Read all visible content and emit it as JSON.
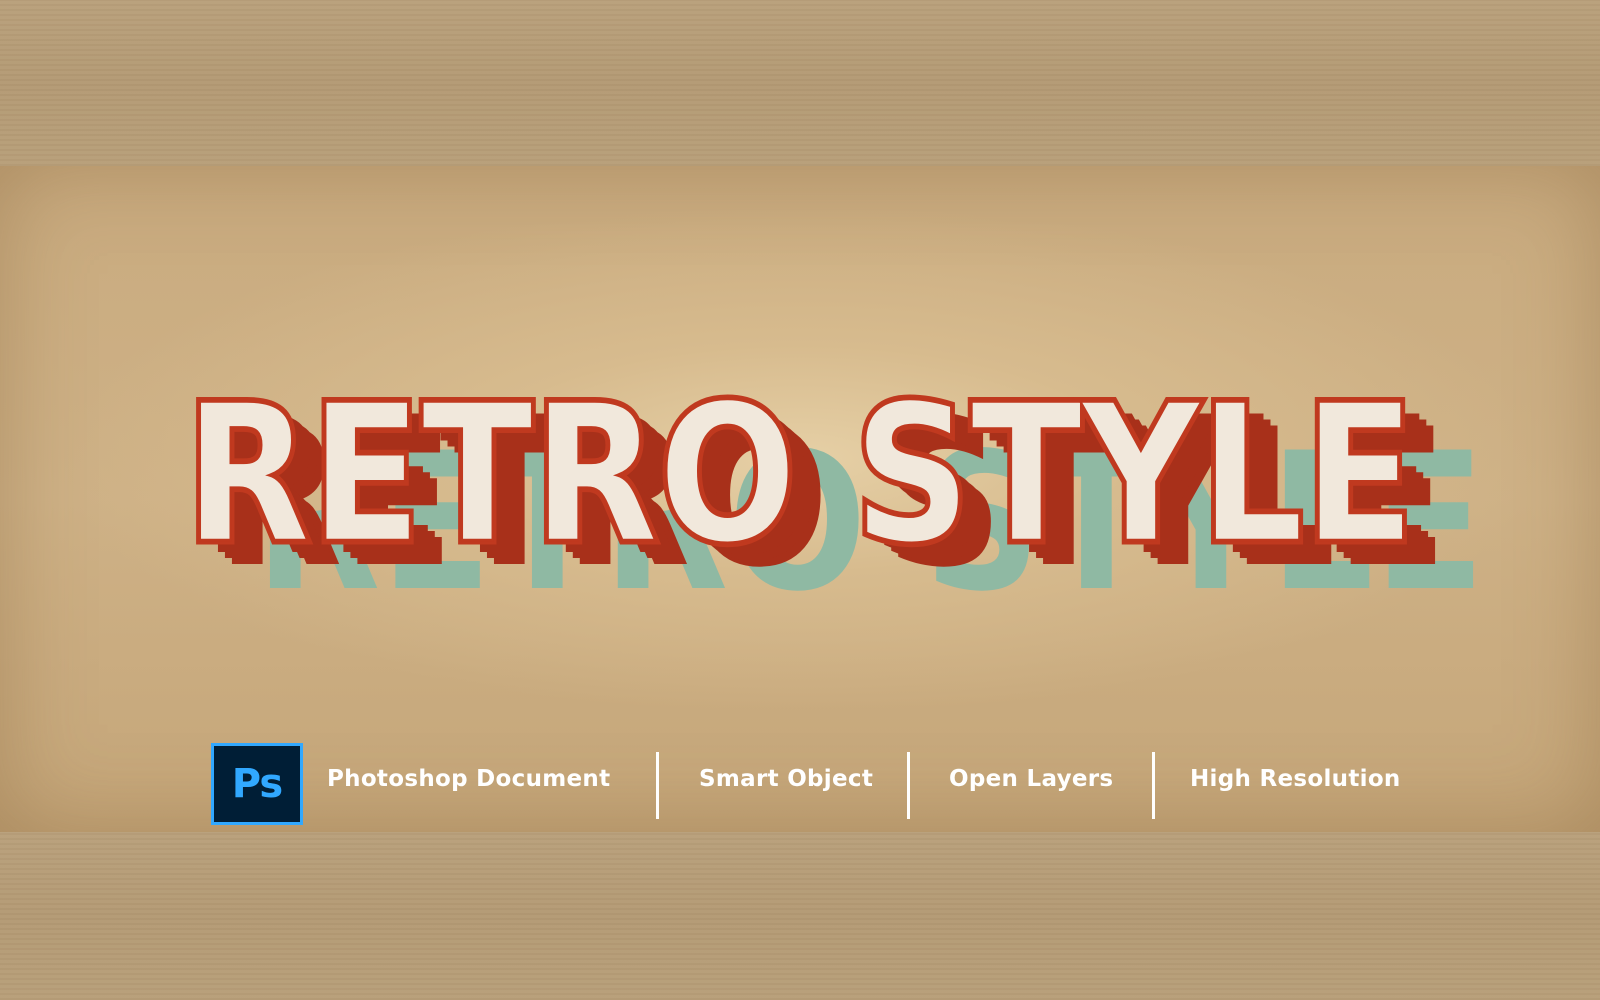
{
  "headline": {
    "text": "RETRO STYLE",
    "face_color": "#f1e8dc",
    "outline_color": "#c0391f",
    "extrude_color": "#a8301a",
    "shadow_color": "#8fb9a3"
  },
  "features": {
    "ps_logo_text": "Ps",
    "ps_logo_bg": "#001e36",
    "ps_logo_accent": "#31a8ff",
    "items": [
      "Photoshop Document",
      "Smart Object",
      "Open Layers",
      "High Resolution"
    ]
  }
}
